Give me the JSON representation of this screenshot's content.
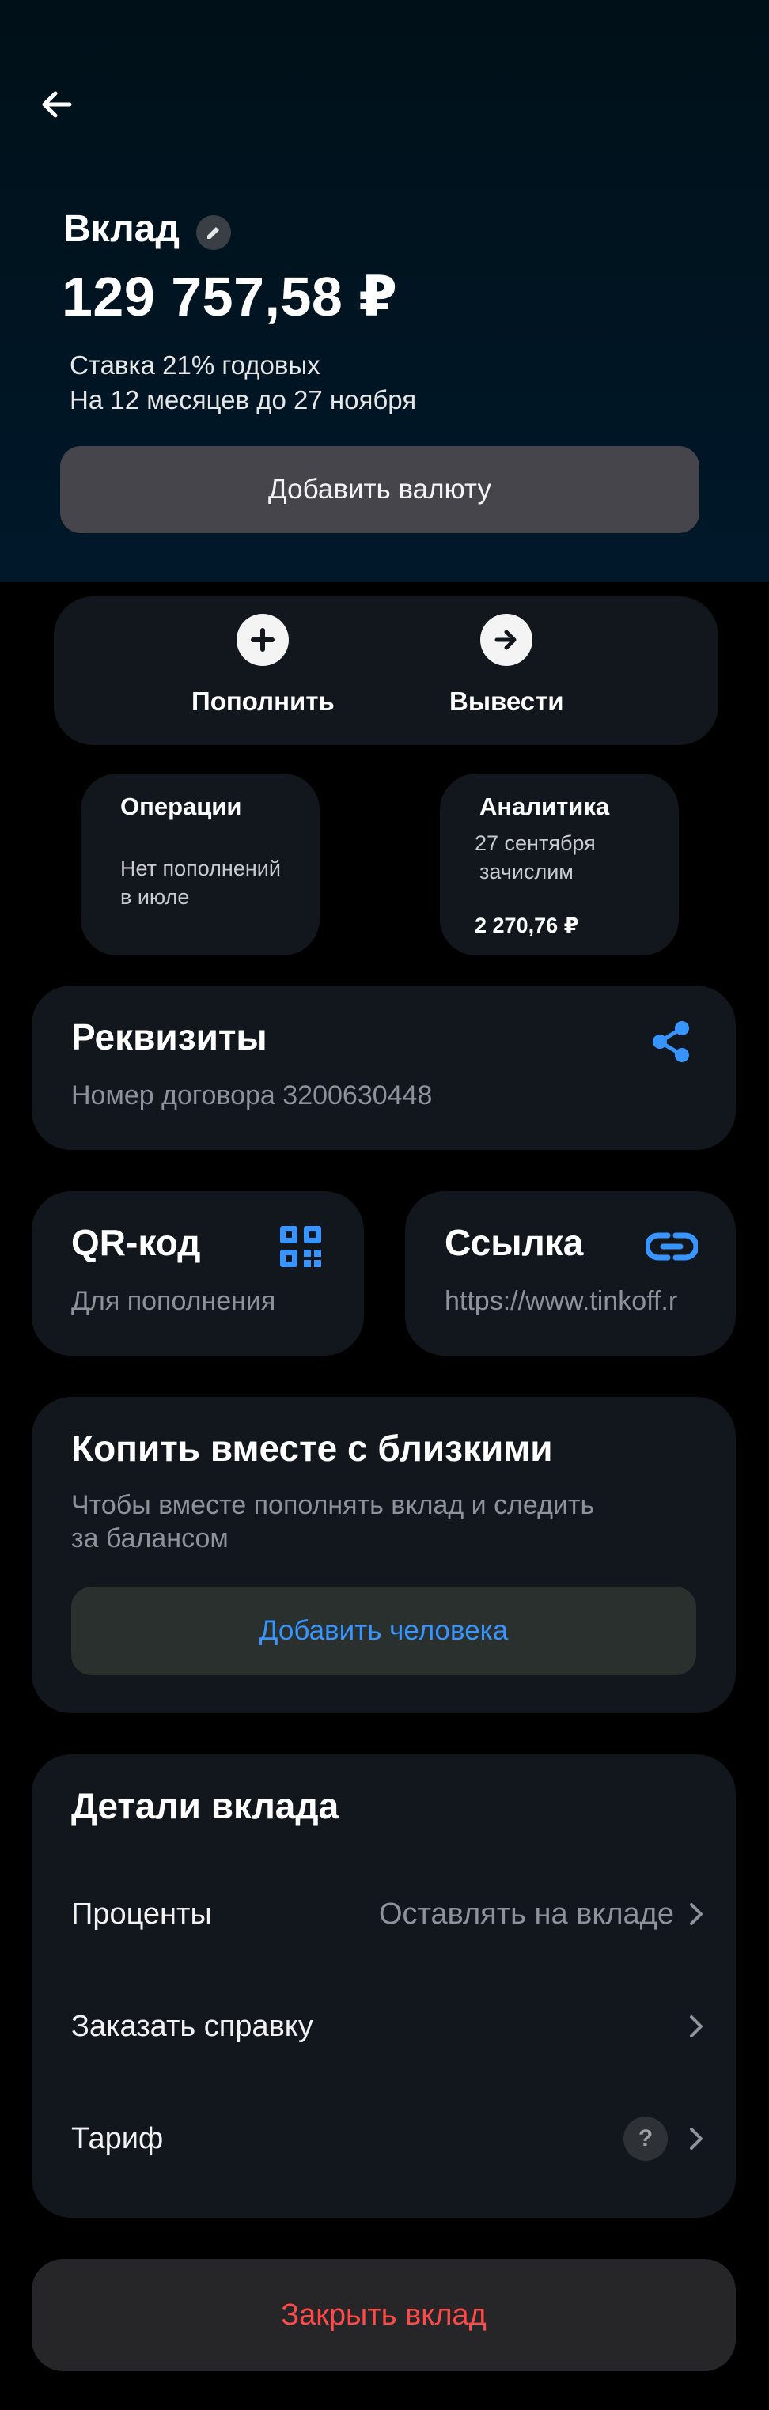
{
  "header": {
    "title": "Вклад",
    "balance": "129 757,58 ₽",
    "rate_line": "Ставка 21% годовых",
    "term_line": "На 12 месяцев до 27 ноября",
    "add_currency_label": "Добавить валюту"
  },
  "actions": {
    "deposit_label": "Пополнить",
    "withdraw_label": "Вывести"
  },
  "operations_card": {
    "title": "Операции",
    "line1": "Нет пополнений",
    "line2": "в июле"
  },
  "analytics_card": {
    "title": "Аналитика",
    "line1": "27 сентября",
    "line2": "зачислим",
    "amount": "2 270,76 ₽"
  },
  "requisites": {
    "title": "Реквизиты",
    "contract": "Номер договора 3200630448"
  },
  "qr": {
    "title": "QR-код",
    "subtitle": "Для пополнения"
  },
  "link": {
    "title": "Ссылка",
    "subtitle": "https://www.tinkoff.r"
  },
  "together": {
    "title": "Копить вместе с близкими",
    "line1": "Чтобы вместе пополнять вклад и следить",
    "line2": "за балансом",
    "button_label": "Добавить человека"
  },
  "details": {
    "title": "Детали вклада",
    "rows": [
      {
        "label": "Проценты",
        "value": "Оставлять на вкладе"
      },
      {
        "label": "Заказать справку",
        "value": ""
      },
      {
        "label": "Тариф",
        "value": ""
      }
    ],
    "help_glyph": "?"
  },
  "close_label": "Закрыть вклад",
  "colors": {
    "accent_blue": "#3894ff",
    "danger": "#ff4a4a",
    "card_bg": "#12161d"
  }
}
